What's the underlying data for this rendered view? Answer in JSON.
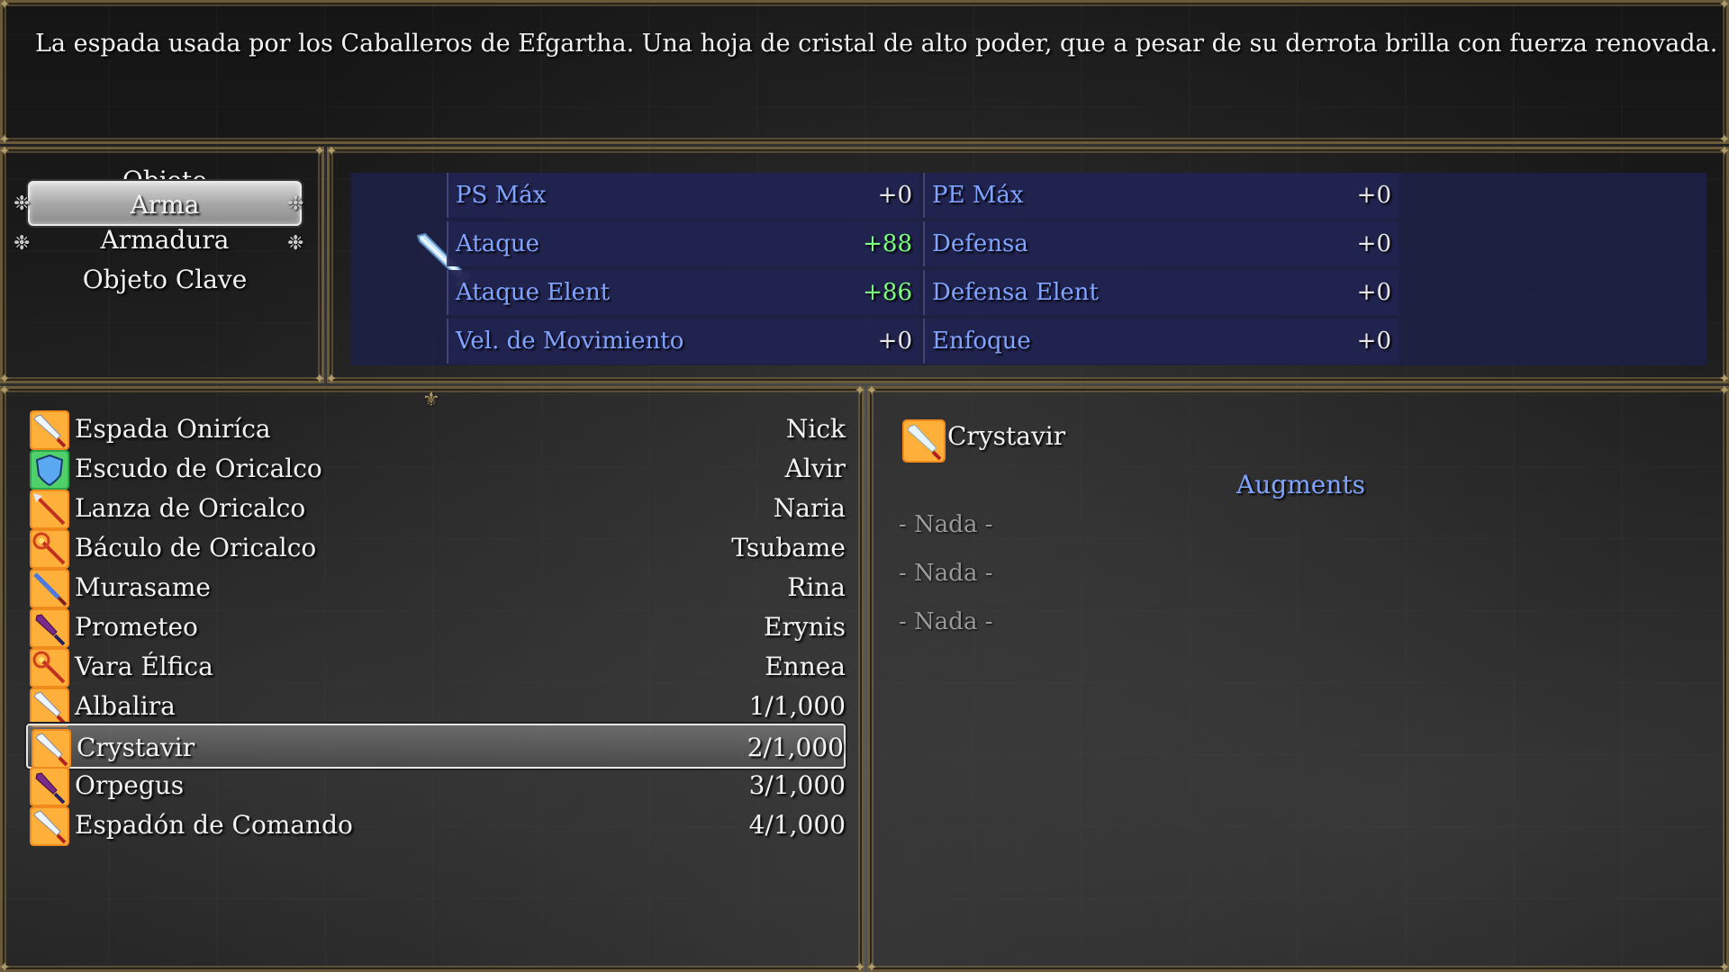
{
  "help": {
    "text": "La espada usada por los Caballeros de Efgartha. Una hoja de cristal de alto poder, que a pesar de su derrota brilla con fuerza renovada."
  },
  "categories": [
    {
      "label": "Objeto",
      "selected": false
    },
    {
      "label": "Arma",
      "selected": true
    },
    {
      "label": "Armadura",
      "selected": false
    },
    {
      "label": "Objeto Clave",
      "selected": false
    }
  ],
  "stats": {
    "left": [
      {
        "name": "PS Máx",
        "value": "+0"
      },
      {
        "name": "Ataque",
        "value": "+88"
      },
      {
        "name": "Ataque Elent",
        "value": "+86"
      },
      {
        "name": "Vel. de Movimiento",
        "value": "+0"
      }
    ],
    "right": [
      {
        "name": "PE Máx",
        "value": "+0"
      },
      {
        "name": "Defensa",
        "value": "+0"
      },
      {
        "name": "Defensa Elent",
        "value": "+0"
      },
      {
        "name": "Enfoque",
        "value": "+0"
      }
    ]
  },
  "items": [
    {
      "name": "Espada Oniríca",
      "owner": "Nick",
      "icon": "sword-icon"
    },
    {
      "name": "Escudo de Oricalco",
      "owner": "Alvir",
      "icon": "shield-icon"
    },
    {
      "name": "Lanza de Oricalco",
      "owner": "Naria",
      "icon": "spear-icon"
    },
    {
      "name": "Báculo de Oricalco",
      "owner": "Tsubame",
      "icon": "staff-icon"
    },
    {
      "name": "Murasame",
      "owner": "Rina",
      "icon": "katana-icon"
    },
    {
      "name": "Prometeo",
      "owner": "Erynis",
      "icon": "dagger-icon"
    },
    {
      "name": "Vara Élfica",
      "owner": "Ennea",
      "icon": "staff-icon"
    },
    {
      "name": "Albalira",
      "owner": "1/1,000",
      "icon": "sword-icon"
    },
    {
      "name": "Crystavir",
      "owner": "2/1,000",
      "icon": "sword-icon"
    },
    {
      "name": "Orpegus",
      "owner": "3/1,000",
      "icon": "dagger-icon"
    },
    {
      "name": "Espadón de Comando",
      "owner": "4/1,000",
      "icon": "sword-icon"
    }
  ],
  "selected_index": 8,
  "detail": {
    "name": "Crystavir",
    "augments_title": "Augments",
    "slots": [
      "- Nada -",
      "- Nada -",
      "- Nada -"
    ]
  },
  "colors": {
    "stat_label": "#7fa3ff",
    "stat_plus": "#7cff7c",
    "stats_bg": "#22244f",
    "frame": "#6b5a3a"
  }
}
